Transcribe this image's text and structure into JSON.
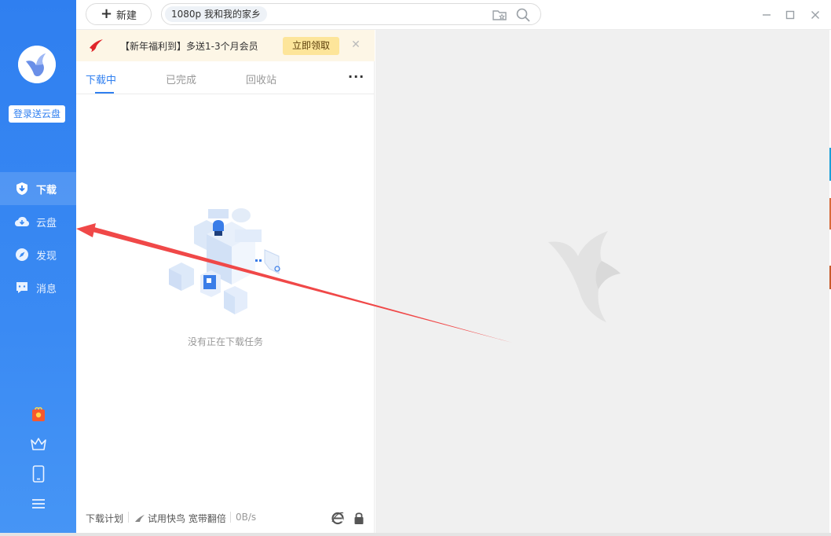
{
  "sidebar": {
    "login_label": "登录送云盘",
    "nav": [
      {
        "label": "下载",
        "icon": "download-shield-icon",
        "active": true
      },
      {
        "label": "云盘",
        "icon": "cloud-icon",
        "active": false
      },
      {
        "label": "发现",
        "icon": "compass-icon",
        "active": false
      },
      {
        "label": "消息",
        "icon": "message-icon",
        "active": false
      }
    ],
    "bottom_icons": [
      "gift-box-icon",
      "crown-icon",
      "phone-icon",
      "menu-icon"
    ]
  },
  "topbar": {
    "new_label": "新建",
    "search_chip": "1080p 我和我的家乡"
  },
  "promo": {
    "text": "【新年福利到】多送1-3个月会员",
    "button": "立即领取"
  },
  "tabs": [
    {
      "label": "下载中",
      "active": true
    },
    {
      "label": "已完成",
      "active": false
    },
    {
      "label": "回收站",
      "active": false
    }
  ],
  "more_label": "···",
  "empty_text": "没有正在下载任务",
  "statusbar": {
    "plan": "下载计划",
    "accel": "试用快鸟 宽带翻倍",
    "speed": "0B/s"
  },
  "colors": {
    "sidebar": "#2f7ff0",
    "accent": "#2f7ff0",
    "promo_bg": "#fdf6e6",
    "promo_button": "#fde59a",
    "annotation_arrow": "#f04848"
  }
}
